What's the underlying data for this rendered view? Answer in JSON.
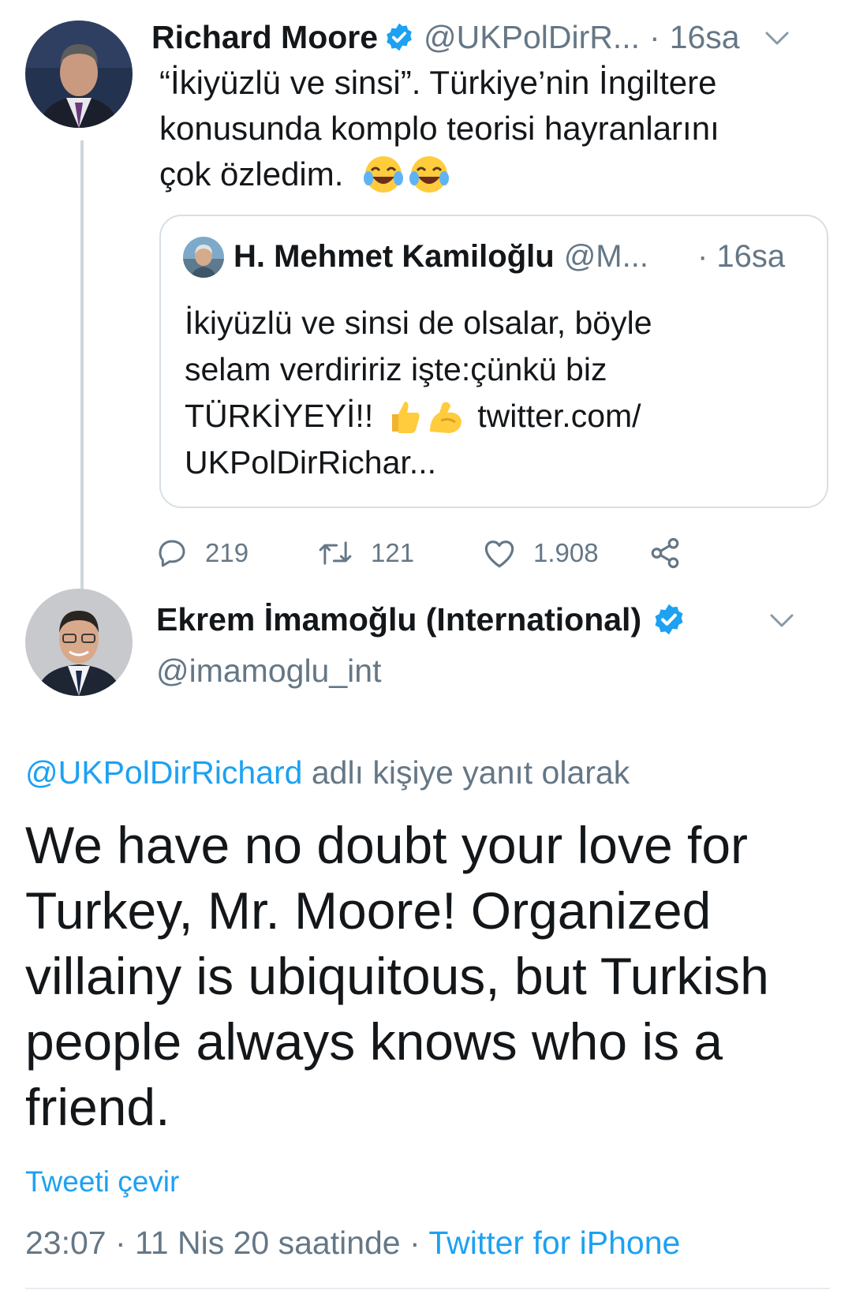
{
  "tweet1": {
    "name": "Richard Moore",
    "handle": "@UKPolDirR...",
    "sep": "·",
    "time": "16sa",
    "body_lines": [
      "“İkiyüzlü ve sinsi”.  Türkiye’nin İngiltere",
      "konusunda komplo teorisi hayranlarını",
      "çok özledim."
    ],
    "emoji": "face-with-tears-of-joy",
    "quote": {
      "name": "H. Mehmet Kamiloğlu",
      "handle": "@M...",
      "time": "· 16sa",
      "line1": "İkiyüzlü ve sinsi de olsalar, böyle",
      "line2": "selam verdiririz işte:çünkü biz",
      "line3_text": "TÜRKİYEYİ!!",
      "line3_link": "twitter.com/",
      "line4": "UKPolDirRichar..."
    },
    "actions": {
      "replies": "219",
      "retweets": "121",
      "likes": "1.908"
    }
  },
  "tweet2": {
    "name": "Ekrem İmamoğlu (International)",
    "handle": "@imamoglu_int",
    "reply_to_user": "@UKPolDirRichard",
    "reply_to_suffix": " adlı kişiye yanıt olarak",
    "text_lines": [
      "We have no doubt your love for",
      "Turkey, Mr. Moore! Organized",
      "villainy is ubiquitous, but Turkish",
      "people always knows who is a",
      "friend."
    ],
    "translate": "Tweeti çevir",
    "timestamp": "23:07 · 11 Nis 20 saatinde · ",
    "source": "Twitter for iPhone"
  },
  "colors": {
    "accent": "#1da1f2",
    "muted": "#657786",
    "text": "#14171a",
    "thread_line": "#ccd6dd"
  }
}
